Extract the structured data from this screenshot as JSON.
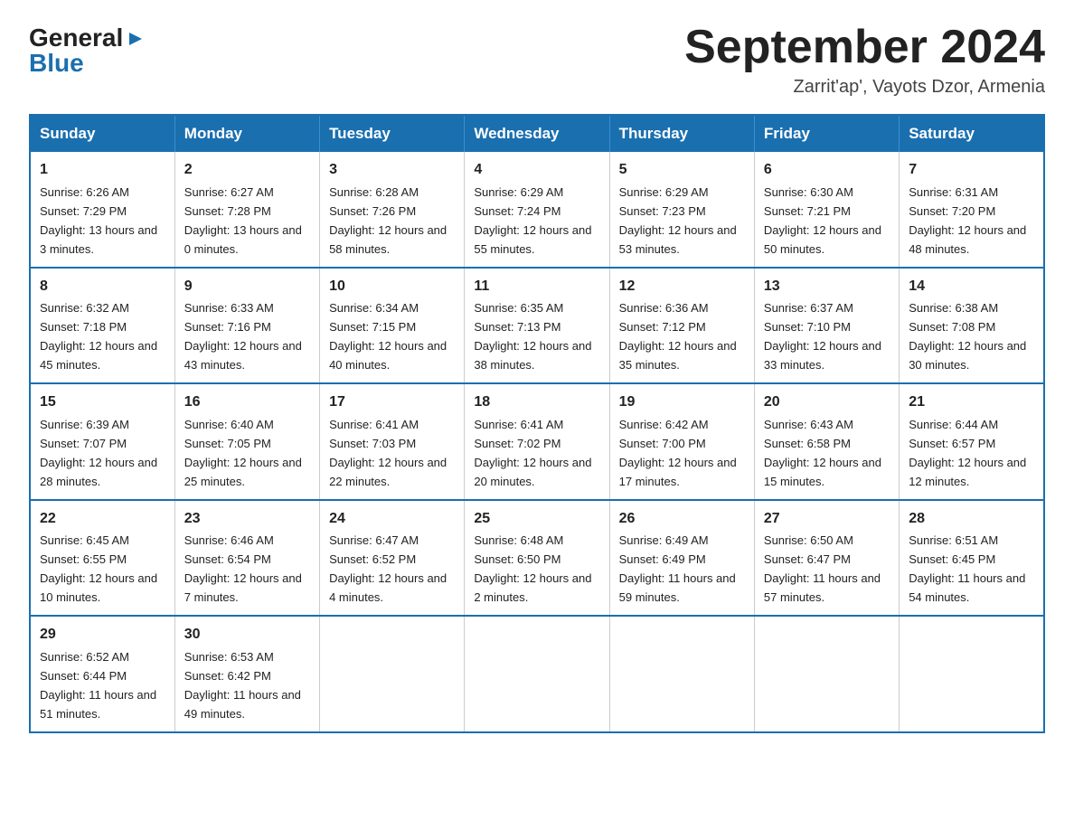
{
  "header": {
    "logo_general": "General",
    "logo_blue": "Blue",
    "month_year": "September 2024",
    "location": "Zarrit'ap', Vayots Dzor, Armenia"
  },
  "weekdays": [
    "Sunday",
    "Monday",
    "Tuesday",
    "Wednesday",
    "Thursday",
    "Friday",
    "Saturday"
  ],
  "weeks": [
    [
      {
        "day": "1",
        "sunrise": "6:26 AM",
        "sunset": "7:29 PM",
        "daylight": "13 hours and 3 minutes."
      },
      {
        "day": "2",
        "sunrise": "6:27 AM",
        "sunset": "7:28 PM",
        "daylight": "13 hours and 0 minutes."
      },
      {
        "day": "3",
        "sunrise": "6:28 AM",
        "sunset": "7:26 PM",
        "daylight": "12 hours and 58 minutes."
      },
      {
        "day": "4",
        "sunrise": "6:29 AM",
        "sunset": "7:24 PM",
        "daylight": "12 hours and 55 minutes."
      },
      {
        "day": "5",
        "sunrise": "6:29 AM",
        "sunset": "7:23 PM",
        "daylight": "12 hours and 53 minutes."
      },
      {
        "day": "6",
        "sunrise": "6:30 AM",
        "sunset": "7:21 PM",
        "daylight": "12 hours and 50 minutes."
      },
      {
        "day": "7",
        "sunrise": "6:31 AM",
        "sunset": "7:20 PM",
        "daylight": "12 hours and 48 minutes."
      }
    ],
    [
      {
        "day": "8",
        "sunrise": "6:32 AM",
        "sunset": "7:18 PM",
        "daylight": "12 hours and 45 minutes."
      },
      {
        "day": "9",
        "sunrise": "6:33 AM",
        "sunset": "7:16 PM",
        "daylight": "12 hours and 43 minutes."
      },
      {
        "day": "10",
        "sunrise": "6:34 AM",
        "sunset": "7:15 PM",
        "daylight": "12 hours and 40 minutes."
      },
      {
        "day": "11",
        "sunrise": "6:35 AM",
        "sunset": "7:13 PM",
        "daylight": "12 hours and 38 minutes."
      },
      {
        "day": "12",
        "sunrise": "6:36 AM",
        "sunset": "7:12 PM",
        "daylight": "12 hours and 35 minutes."
      },
      {
        "day": "13",
        "sunrise": "6:37 AM",
        "sunset": "7:10 PM",
        "daylight": "12 hours and 33 minutes."
      },
      {
        "day": "14",
        "sunrise": "6:38 AM",
        "sunset": "7:08 PM",
        "daylight": "12 hours and 30 minutes."
      }
    ],
    [
      {
        "day": "15",
        "sunrise": "6:39 AM",
        "sunset": "7:07 PM",
        "daylight": "12 hours and 28 minutes."
      },
      {
        "day": "16",
        "sunrise": "6:40 AM",
        "sunset": "7:05 PM",
        "daylight": "12 hours and 25 minutes."
      },
      {
        "day": "17",
        "sunrise": "6:41 AM",
        "sunset": "7:03 PM",
        "daylight": "12 hours and 22 minutes."
      },
      {
        "day": "18",
        "sunrise": "6:41 AM",
        "sunset": "7:02 PM",
        "daylight": "12 hours and 20 minutes."
      },
      {
        "day": "19",
        "sunrise": "6:42 AM",
        "sunset": "7:00 PM",
        "daylight": "12 hours and 17 minutes."
      },
      {
        "day": "20",
        "sunrise": "6:43 AM",
        "sunset": "6:58 PM",
        "daylight": "12 hours and 15 minutes."
      },
      {
        "day": "21",
        "sunrise": "6:44 AM",
        "sunset": "6:57 PM",
        "daylight": "12 hours and 12 minutes."
      }
    ],
    [
      {
        "day": "22",
        "sunrise": "6:45 AM",
        "sunset": "6:55 PM",
        "daylight": "12 hours and 10 minutes."
      },
      {
        "day": "23",
        "sunrise": "6:46 AM",
        "sunset": "6:54 PM",
        "daylight": "12 hours and 7 minutes."
      },
      {
        "day": "24",
        "sunrise": "6:47 AM",
        "sunset": "6:52 PM",
        "daylight": "12 hours and 4 minutes."
      },
      {
        "day": "25",
        "sunrise": "6:48 AM",
        "sunset": "6:50 PM",
        "daylight": "12 hours and 2 minutes."
      },
      {
        "day": "26",
        "sunrise": "6:49 AM",
        "sunset": "6:49 PM",
        "daylight": "11 hours and 59 minutes."
      },
      {
        "day": "27",
        "sunrise": "6:50 AM",
        "sunset": "6:47 PM",
        "daylight": "11 hours and 57 minutes."
      },
      {
        "day": "28",
        "sunrise": "6:51 AM",
        "sunset": "6:45 PM",
        "daylight": "11 hours and 54 minutes."
      }
    ],
    [
      {
        "day": "29",
        "sunrise": "6:52 AM",
        "sunset": "6:44 PM",
        "daylight": "11 hours and 51 minutes."
      },
      {
        "day": "30",
        "sunrise": "6:53 AM",
        "sunset": "6:42 PM",
        "daylight": "11 hours and 49 minutes."
      },
      null,
      null,
      null,
      null,
      null
    ]
  ]
}
